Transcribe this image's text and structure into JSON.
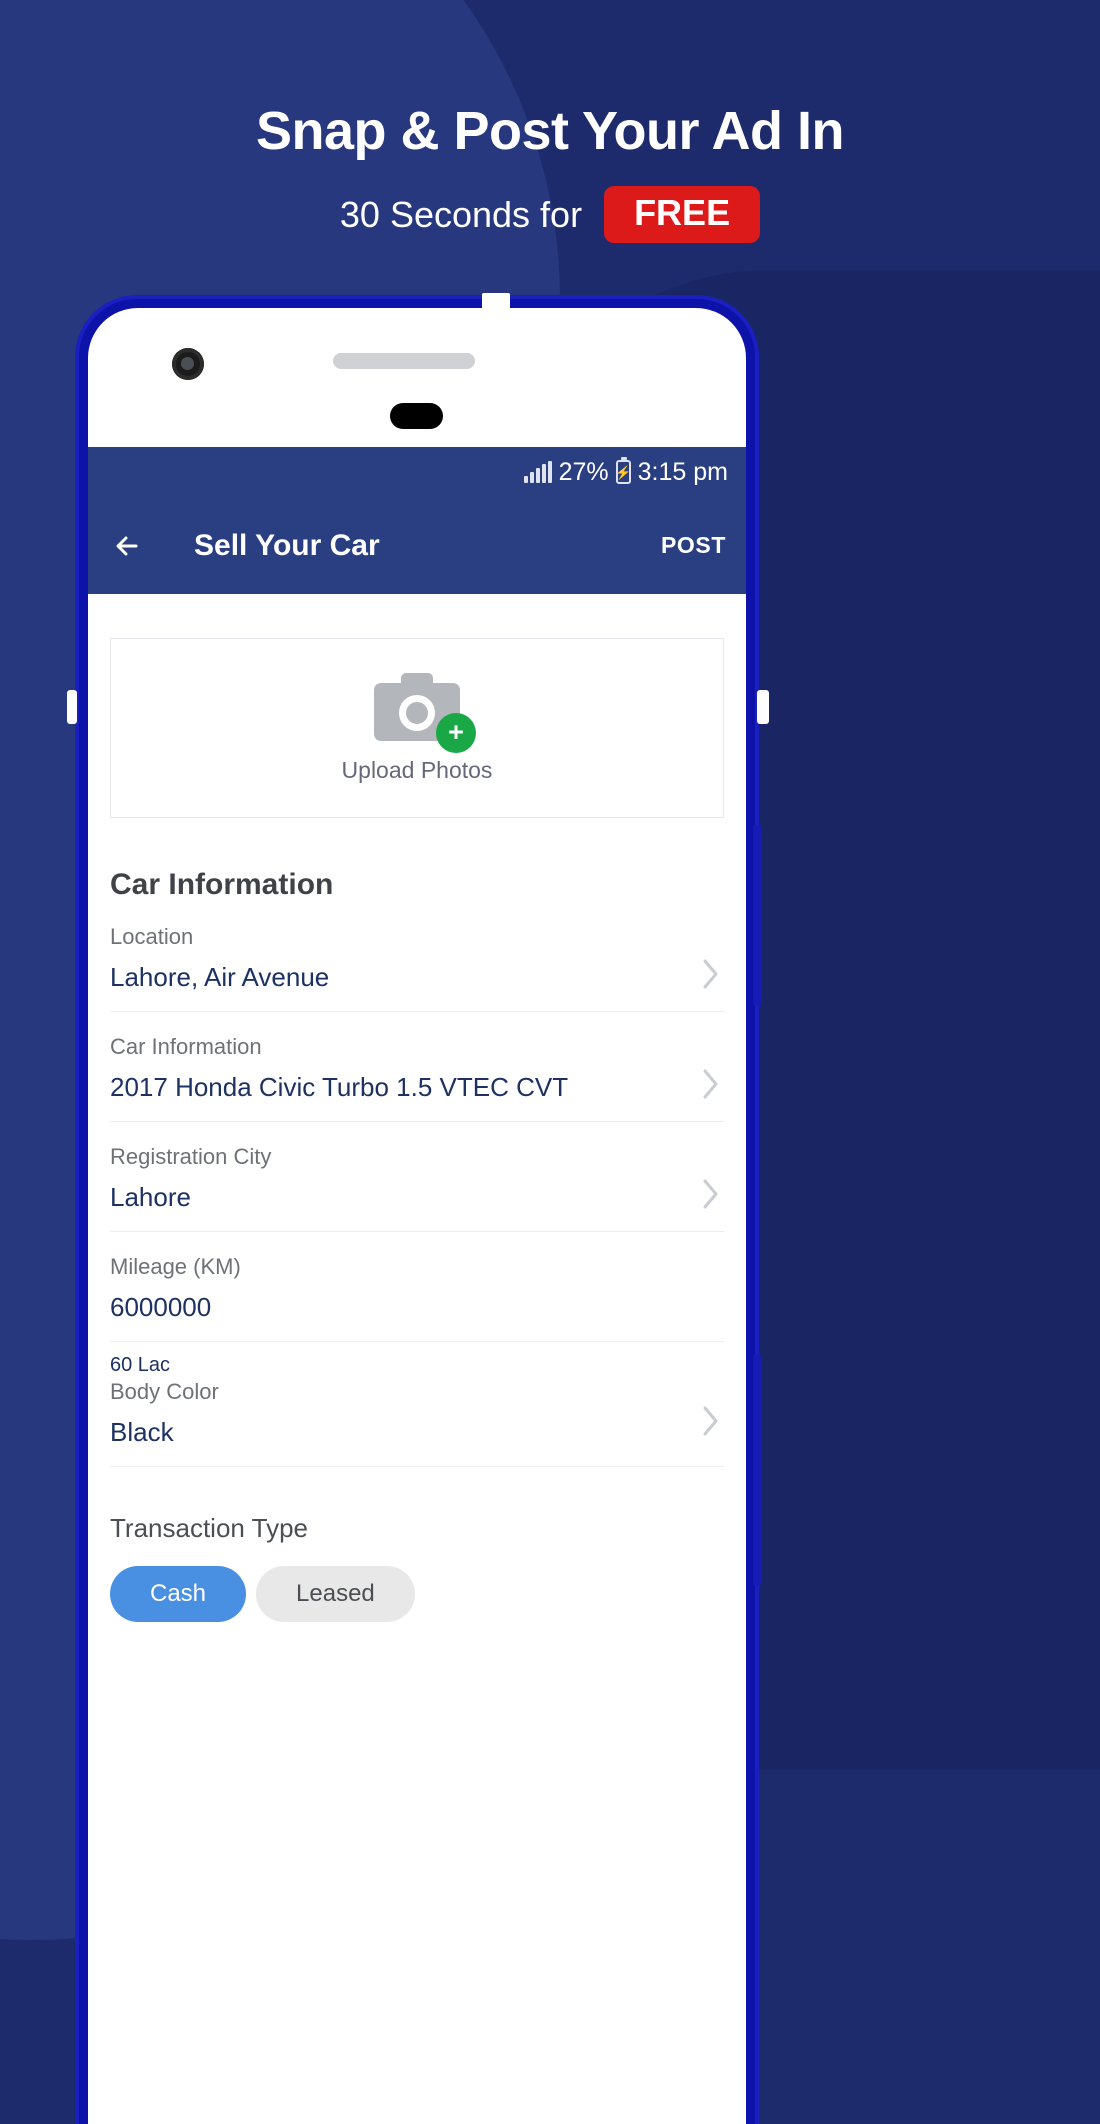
{
  "header": {
    "line1": "Snap & Post Your Ad In",
    "line2": "30 Seconds for",
    "badge": "FREE",
    "badge_color": "#dd1a1a",
    "background_color": "#1d2a6c"
  },
  "phone": {
    "status_bar": {
      "battery_percent": "27%",
      "time": "3:15 pm",
      "signal_icon": "signal-bars-icon",
      "battery_icon": "battery-charging-icon"
    },
    "app_bar": {
      "back_icon": "back-arrow-icon",
      "title": "Sell Your Car",
      "action": "POST",
      "color": "#2a3f82"
    },
    "upload": {
      "icon": "camera-icon",
      "add_icon": "plus-badge-icon",
      "label": "Upload Photos",
      "accent_color": "#19a845"
    },
    "section_title": "Car Information",
    "fields": [
      {
        "label": "Location",
        "value": "Lahore, Air Avenue",
        "chevron": true,
        "helper": ""
      },
      {
        "label": "Car Information",
        "value": "2017 Honda Civic Turbo 1.5 VTEC CVT",
        "chevron": true,
        "helper": ""
      },
      {
        "label": "Registration City",
        "value": "Lahore",
        "chevron": true,
        "helper": ""
      },
      {
        "label": "Mileage (KM)",
        "value": "6000000",
        "chevron": false,
        "helper": ""
      },
      {
        "label": "Body Color",
        "value": "Black",
        "chevron": true,
        "helper": ""
      }
    ],
    "mileage_helper": "60 Lac",
    "transaction": {
      "label": "Transaction Type",
      "options": [
        {
          "label": "Cash",
          "selected": true
        },
        {
          "label": "Leased",
          "selected": false
        }
      ],
      "selected_color": "#4a90e2",
      "unselected_color": "#e8e8e8"
    }
  }
}
